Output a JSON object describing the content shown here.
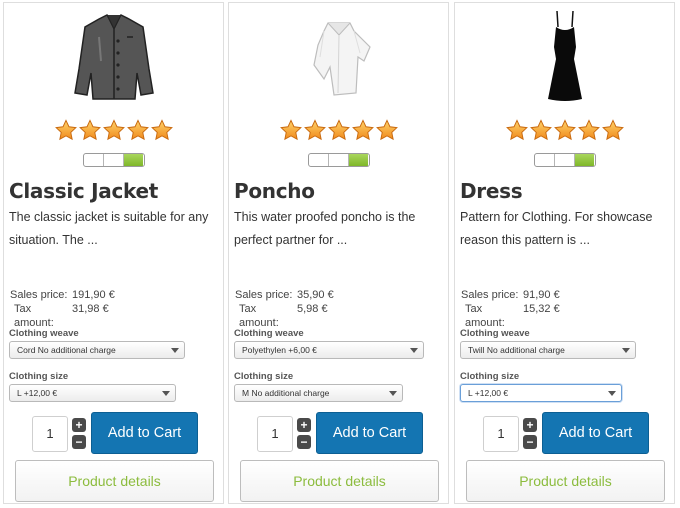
{
  "colors": {
    "accent_blue": "#1475b2",
    "details_text_green": "#8cbc3e",
    "stock_green": "#8bc34a",
    "star_orange": "#f5a623"
  },
  "products": [
    {
      "name": "Classic Jacket",
      "image_icon": "jacket-icon",
      "rating_stars": 5,
      "stock_level": "1/3",
      "description": "The classic jacket is suitable for any situation. The ...",
      "sales_price_label": "Sales price:",
      "sales_price": "191,90 €",
      "tax_label": "Tax amount:",
      "tax": "31,98 €",
      "weave_label": "Clothing weave",
      "weave_value": "Cord No additional charge",
      "size_label": "Clothing size",
      "size_value": "L +12,00 €",
      "quantity": "1",
      "plus": "+",
      "minus": "−",
      "add_to_cart": "Add to Cart",
      "details": "Product details"
    },
    {
      "name": "Poncho",
      "image_icon": "poncho-icon",
      "rating_stars": 5,
      "stock_level": "1/3",
      "description": "This water proofed poncho is the perfect partner for ...",
      "sales_price_label": "Sales price:",
      "sales_price": "35,90 €",
      "tax_label": "Tax amount:",
      "tax": "5,98 €",
      "weave_label": "Clothing weave",
      "weave_value": "Polyethylen +6,00 €",
      "size_label": "Clothing size",
      "size_value": "M No additional charge",
      "quantity": "1",
      "plus": "+",
      "minus": "−",
      "add_to_cart": "Add to Cart",
      "details": "Product details"
    },
    {
      "name": "Dress",
      "image_icon": "dress-icon",
      "rating_stars": 5,
      "stock_level": "1/3",
      "description": "Pattern for Clothing. For showcase reason this pattern is ...",
      "sales_price_label": "Sales price:",
      "sales_price": "91,90 €",
      "tax_label": "Tax amount:",
      "tax": "15,32 €",
      "weave_label": "Clothing weave",
      "weave_value": "Twill No additional charge",
      "size_label": "Clothing size",
      "size_value": "L +12,00 €",
      "quantity": "1",
      "plus": "+",
      "minus": "−",
      "add_to_cart": "Add to Cart",
      "details": "Product details"
    }
  ]
}
